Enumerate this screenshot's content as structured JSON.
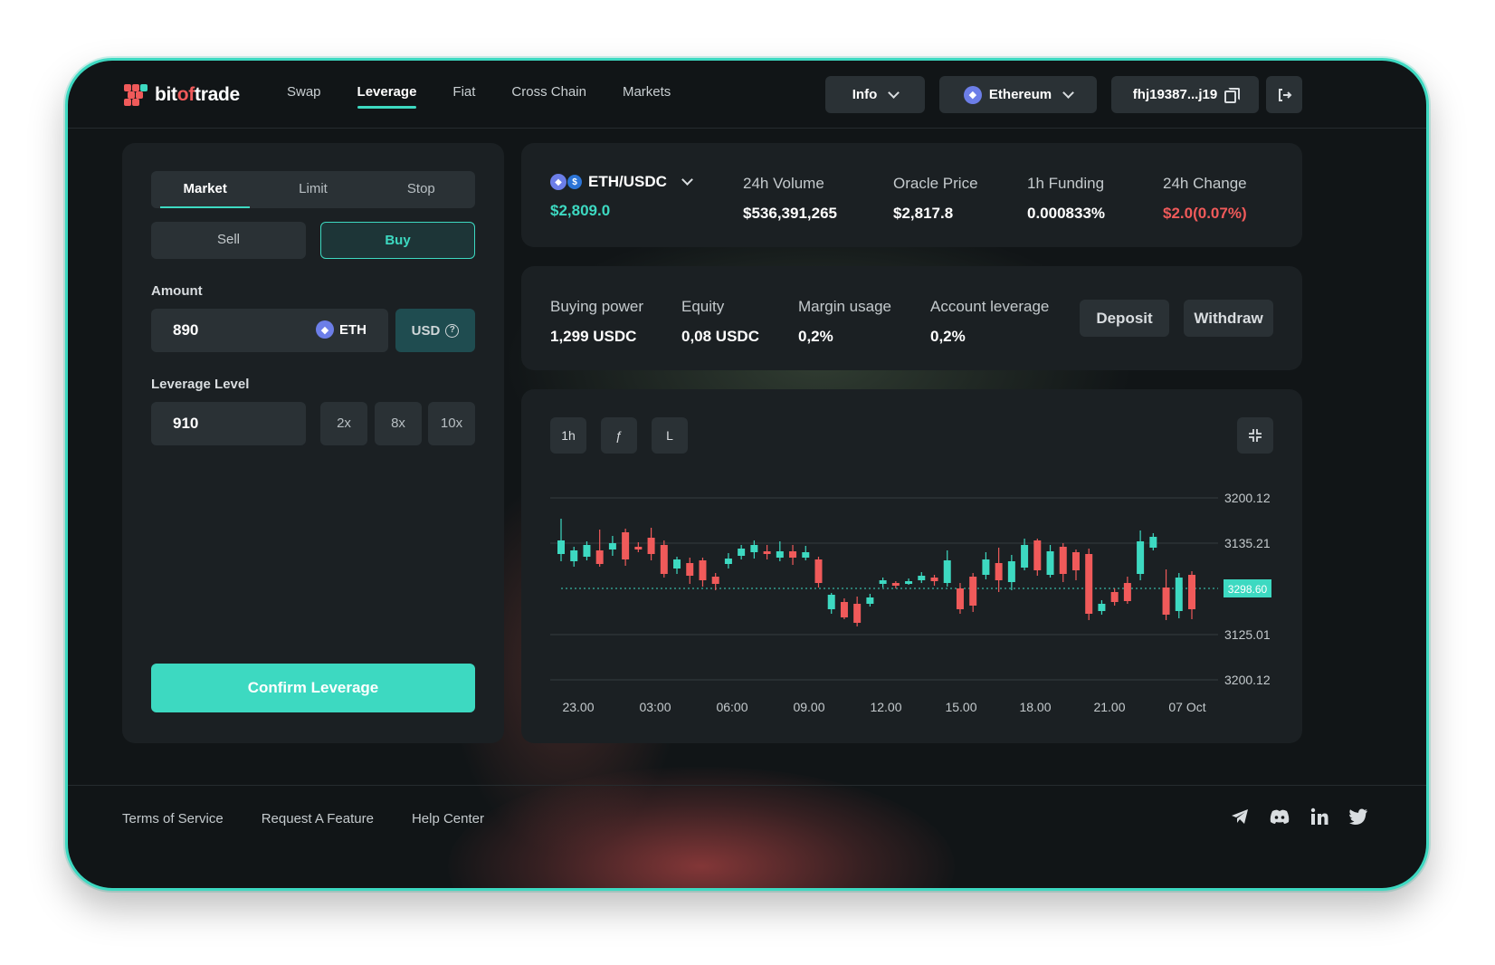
{
  "brand": {
    "name_part1": "bit",
    "name_accent": "of",
    "name_part2": "trade"
  },
  "nav": {
    "items": [
      "Swap",
      "Leverage",
      "Fiat",
      "Cross Chain",
      "Markets"
    ],
    "active": "Leverage"
  },
  "header": {
    "info_label": "Info",
    "network_label": "Ethereum",
    "wallet_address": "fhj19387...j19"
  },
  "order_form": {
    "tabs": [
      "Market",
      "Limit",
      "Stop"
    ],
    "active_tab": "Market",
    "sell_label": "Sell",
    "buy_label": "Buy",
    "amount_label": "Amount",
    "amount_value": "890",
    "amount_currency": "ETH",
    "usd_label": "USD",
    "leverage_label": "Leverage Level",
    "leverage_value": "910",
    "leverage_presets": [
      "2x",
      "8x",
      "10x"
    ],
    "confirm_label": "Confirm Leverage"
  },
  "market": {
    "pair": "ETH/USDC",
    "price": "$2,809.0",
    "stats": [
      {
        "label": "24h Volume",
        "value": "$536,391,265"
      },
      {
        "label": "Oracle Price",
        "value": "$2,817.8"
      },
      {
        "label": "1h Funding",
        "value": "0.000833%"
      },
      {
        "label": "24h Change",
        "value": "$2.0(0.07%)"
      }
    ]
  },
  "account": {
    "items": [
      {
        "label": "Buying power",
        "value": "1,299 USDC"
      },
      {
        "label": "Equity",
        "value": "0,08 USDC"
      },
      {
        "label": "Margin usage",
        "value": "0,2%"
      },
      {
        "label": "Account leverage",
        "value": "0,2%"
      }
    ],
    "deposit_label": "Deposit",
    "withdraw_label": "Withdraw"
  },
  "chart_toolbar": {
    "timeframe": "1h",
    "indicator": "ƒ",
    "line": "L"
  },
  "chart_data": {
    "type": "candlestick",
    "y_tick_labels": [
      "3200.12",
      "3135.21",
      "3298.60",
      "3125.01",
      "3200.12"
    ],
    "current_price_label": "3298.60",
    "x_tick_labels": [
      "23.00",
      "03:00",
      "06:00",
      "09.00",
      "12.00",
      "15.00",
      "18.00",
      "21.00",
      "07 Oct"
    ],
    "grid": true,
    "colors": {
      "up": "#3dd9c1",
      "down": "#f05a5a"
    },
    "candles": [
      {
        "o": 0.38,
        "c": 0.53,
        "h": 0.77,
        "l": 0.3
      },
      {
        "o": 0.3,
        "c": 0.42,
        "h": 0.46,
        "l": 0.24
      },
      {
        "o": 0.35,
        "c": 0.48,
        "h": 0.52,
        "l": 0.31
      },
      {
        "o": 0.42,
        "c": 0.27,
        "h": 0.65,
        "l": 0.24
      },
      {
        "o": 0.43,
        "c": 0.5,
        "h": 0.58,
        "l": 0.36
      },
      {
        "o": 0.62,
        "c": 0.32,
        "h": 0.66,
        "l": 0.25
      },
      {
        "o": 0.46,
        "c": 0.43,
        "h": 0.51,
        "l": 0.4
      },
      {
        "o": 0.56,
        "c": 0.38,
        "h": 0.67,
        "l": 0.31
      },
      {
        "o": 0.48,
        "c": 0.16,
        "h": 0.53,
        "l": 0.12
      },
      {
        "o": 0.22,
        "c": 0.32,
        "h": 0.35,
        "l": 0.16
      },
      {
        "o": 0.28,
        "c": 0.14,
        "h": 0.34,
        "l": 0.05
      },
      {
        "o": 0.31,
        "c": 0.09,
        "h": 0.34,
        "l": 0.02
      },
      {
        "o": 0.13,
        "c": 0.05,
        "h": 0.17,
        "l": -0.02
      },
      {
        "o": 0.27,
        "c": 0.33,
        "h": 0.39,
        "l": 0.22
      },
      {
        "o": 0.36,
        "c": 0.44,
        "h": 0.48,
        "l": 0.32
      },
      {
        "o": 0.4,
        "c": 0.48,
        "h": 0.53,
        "l": 0.33
      },
      {
        "o": 0.41,
        "c": 0.38,
        "h": 0.48,
        "l": 0.32
      },
      {
        "o": 0.34,
        "c": 0.41,
        "h": 0.52,
        "l": 0.3
      },
      {
        "o": 0.41,
        "c": 0.34,
        "h": 0.48,
        "l": 0.26
      },
      {
        "o": 0.34,
        "c": 0.4,
        "h": 0.47,
        "l": 0.31
      },
      {
        "o": 0.32,
        "c": 0.06,
        "h": 0.35,
        "l": 0.01
      },
      {
        "o": -0.23,
        "c": -0.07,
        "h": -0.05,
        "l": -0.28
      },
      {
        "o": -0.15,
        "c": -0.32,
        "h": -0.11,
        "l": -0.34
      },
      {
        "o": -0.17,
        "c": -0.38,
        "h": -0.09,
        "l": -0.42
      },
      {
        "o": -0.17,
        "c": -0.1,
        "h": -0.06,
        "l": -0.2
      },
      {
        "o": 0.05,
        "c": 0.09,
        "h": 0.12,
        "l": 0.01
      },
      {
        "o": 0.06,
        "c": 0.03,
        "h": 0.08,
        "l": 0.0
      },
      {
        "o": 0.05,
        "c": 0.08,
        "h": 0.11,
        "l": 0.04
      },
      {
        "o": 0.09,
        "c": 0.14,
        "h": 0.18,
        "l": 0.06
      },
      {
        "o": 0.12,
        "c": 0.08,
        "h": 0.15,
        "l": 0.03
      },
      {
        "o": 0.06,
        "c": 0.31,
        "h": 0.42,
        "l": 0.02
      },
      {
        "o": 0.0,
        "c": -0.23,
        "h": 0.06,
        "l": -0.28
      },
      {
        "o": 0.13,
        "c": -0.19,
        "h": 0.17,
        "l": -0.26
      },
      {
        "o": 0.15,
        "c": 0.32,
        "h": 0.4,
        "l": 0.1
      },
      {
        "o": 0.28,
        "c": 0.09,
        "h": 0.45,
        "l": -0.04
      },
      {
        "o": 0.07,
        "c": 0.3,
        "h": 0.37,
        "l": -0.02
      },
      {
        "o": 0.23,
        "c": 0.48,
        "h": 0.55,
        "l": 0.2
      },
      {
        "o": 0.53,
        "c": 0.2,
        "h": 0.55,
        "l": 0.14
      },
      {
        "o": 0.15,
        "c": 0.41,
        "h": 0.48,
        "l": 0.12
      },
      {
        "o": 0.46,
        "c": 0.16,
        "h": 0.5,
        "l": 0.07
      },
      {
        "o": 0.4,
        "c": 0.2,
        "h": 0.43,
        "l": 0.09
      },
      {
        "o": 0.38,
        "c": -0.28,
        "h": 0.44,
        "l": -0.35
      },
      {
        "o": -0.25,
        "c": -0.17,
        "h": -0.13,
        "l": -0.29
      },
      {
        "o": -0.04,
        "c": -0.15,
        "h": 0.0,
        "l": -0.19
      },
      {
        "o": 0.06,
        "c": -0.14,
        "h": 0.13,
        "l": -0.17
      },
      {
        "o": 0.16,
        "c": 0.52,
        "h": 0.64,
        "l": 0.09
      },
      {
        "o": 0.45,
        "c": 0.57,
        "h": 0.61,
        "l": 0.42
      },
      {
        "o": 0.01,
        "c": -0.29,
        "h": 0.21,
        "l": -0.35
      },
      {
        "o": -0.25,
        "c": 0.12,
        "h": 0.17,
        "l": -0.33
      },
      {
        "o": 0.15,
        "c": -0.23,
        "h": 0.19,
        "l": -0.34
      }
    ]
  },
  "footer": {
    "links": [
      "Terms of Service",
      "Request A Feature",
      "Help Center"
    ]
  },
  "social_icons": [
    "telegram-icon",
    "discord-icon",
    "linkedin-icon",
    "twitter-icon"
  ]
}
